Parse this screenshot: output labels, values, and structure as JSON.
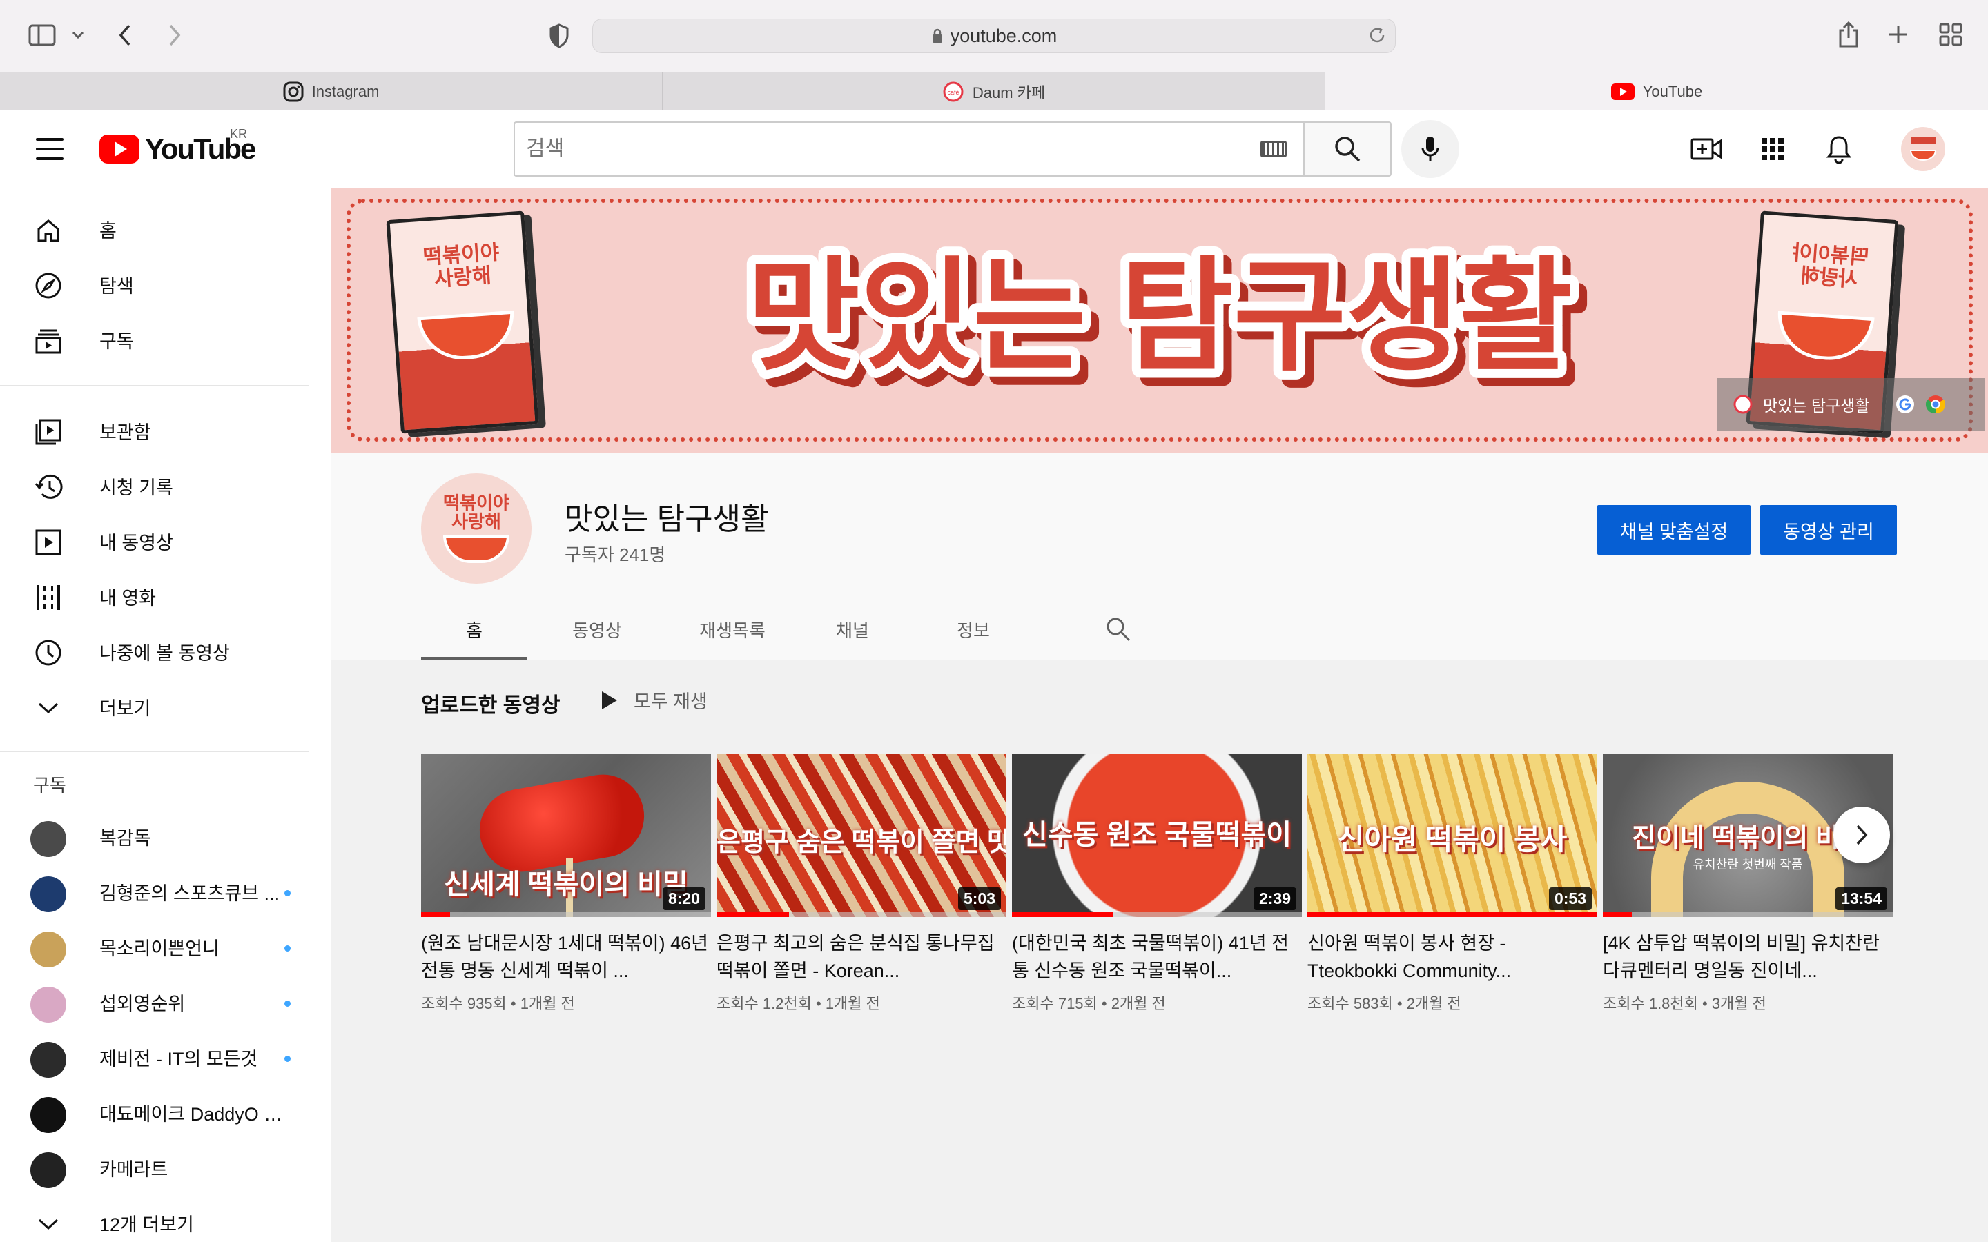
{
  "browser": {
    "url": "youtube.com",
    "tabs": [
      {
        "label": "Instagram",
        "icon": "instagram-icon"
      },
      {
        "label": "Daum 카페",
        "icon": "daum-icon"
      },
      {
        "label": "YouTube",
        "icon": "youtube-icon"
      }
    ]
  },
  "header": {
    "logo_text": "YouTube",
    "region": "KR",
    "search_placeholder": "검색"
  },
  "sidebar": {
    "primary": [
      {
        "label": "홈",
        "icon": "home-icon"
      },
      {
        "label": "탐색",
        "icon": "compass-icon"
      },
      {
        "label": "구독",
        "icon": "subscriptions-icon"
      }
    ],
    "library": [
      {
        "label": "보관함",
        "icon": "library-icon"
      },
      {
        "label": "시청 기록",
        "icon": "history-icon"
      },
      {
        "label": "내 동영상",
        "icon": "my-videos-icon"
      },
      {
        "label": "내 영화",
        "icon": "movies-icon"
      },
      {
        "label": "나중에 볼 동영상",
        "icon": "watch-later-icon"
      },
      {
        "label": "더보기",
        "icon": "chevron-down-icon"
      }
    ],
    "subs_title": "구독",
    "subscriptions": [
      {
        "label": "복감독",
        "color": "#4a4a4a",
        "dot": false
      },
      {
        "label": "김형준의 스포츠큐브 ...",
        "color": "#1d3b6e",
        "dot": true
      },
      {
        "label": "목소리이쁜언니",
        "color": "#c9a25a",
        "dot": true
      },
      {
        "label": "섭외영순위",
        "color": "#d9a8c4",
        "dot": true
      },
      {
        "label": "제비전 - IT의 모든것",
        "color": "#2b2b2b",
        "dot": true
      },
      {
        "label": "대됴메이크 DaddyO m...",
        "color": "#111111",
        "dot": false
      },
      {
        "label": "카메라트",
        "color": "#222222",
        "dot": false
      }
    ],
    "more_subs": "12개 더보기"
  },
  "banner": {
    "title": "맛있는 탐구생활",
    "link_label": "맛있는 탐구생활",
    "book_left_title": "떡볶이야 사랑해",
    "book_right_title": "떡볶이야 사랑해"
  },
  "channel": {
    "name": "맛있는 탐구생활",
    "subscribers": "구독자 241명",
    "avatar_text": "떡볶이야 사랑해",
    "customize_label": "채널 맞춤설정",
    "manage_label": "동영상 관리",
    "tabs": [
      "홈",
      "동영상",
      "재생목록",
      "채널",
      "정보"
    ]
  },
  "shelf": {
    "title": "업로드한 동영상",
    "play_all": "모두 재생",
    "videos": [
      {
        "caption": "신세계 떡볶이의 비밀",
        "duration": "8:20",
        "title": "(원조 남대문시장 1세대 떡볶이) 46년 전통 명동 신세계 떡볶이 ...",
        "meta": "조회수 935회 • 1개월 전",
        "progress": 0.1
      },
      {
        "caption": "은평구 숨은 떡볶이 쫄면 맛집",
        "duration": "5:03",
        "title": "은평구 최고의 숨은 분식집 통나무집 떡볶이 쫄면 - Korean...",
        "meta": "조회수 1.2천회 • 1개월 전",
        "progress": 0.25
      },
      {
        "caption": "신수동 원조 국물떡볶이",
        "duration": "2:39",
        "title": "(대한민국 최초 국물떡볶이) 41년 전통 신수동 원조 국물떡볶이...",
        "meta": "조회수 715회 • 2개월 전",
        "progress": 0.35
      },
      {
        "caption": "신아원 떡볶이 봉사",
        "duration": "0:53",
        "title": "신아원 떡볶이 봉사 현장 - Tteokbokki Community...",
        "meta": "조회수 583회 • 2개월 전",
        "progress": 1.0
      },
      {
        "caption": "진이네 떡볶이의 비밀",
        "subcaption": "유치찬란 첫번째 작품",
        "duration": "13:54",
        "title": "[4K 삼투압 떡볶이의 비밀] 유치찬란 다큐멘터리 명일동 진이네...",
        "meta": "조회수 1.8천회 • 3개월 전",
        "progress": 0.1
      }
    ]
  },
  "colors": {
    "youtube_red": "#ff0000",
    "button_blue": "#065fd4",
    "banner_pink": "#f6cfcb",
    "banner_red": "#d64535"
  }
}
